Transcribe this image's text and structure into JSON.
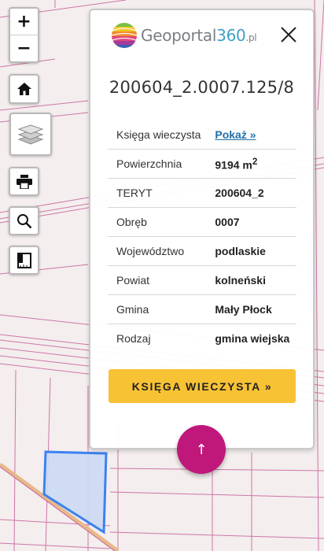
{
  "zoom": {
    "in_label": "+",
    "out_label": "−"
  },
  "panel": {
    "logo": {
      "name": "Geoportal",
      "number": "360",
      "tld": ".pl"
    },
    "parcel_id": "200604_2.0007.125/8",
    "rows": [
      {
        "label": "Księga wieczysta",
        "value": "Pokaż »",
        "link": true
      },
      {
        "label": "Powierzchnia",
        "value": "9194 m",
        "sup": "2"
      },
      {
        "label": "TERYT",
        "value": "200604_2"
      },
      {
        "label": "Obręb",
        "value": "0007"
      },
      {
        "label": "Województwo",
        "value": "podlaskie"
      },
      {
        "label": "Powiat",
        "value": "kolneński"
      },
      {
        "label": "Gmina",
        "value": "Mały Płock"
      },
      {
        "label": "Rodzaj",
        "value": "gmina wiejska"
      }
    ],
    "button_label": "KSIĘGA WIECZYSTA »"
  },
  "fab_label": "↑",
  "colors": {
    "map_background": "#f4eeee",
    "parcel_lines": "#c8609a",
    "selected_parcel": "#3b82f0",
    "road": "#e7b98a",
    "button": "#f8c235",
    "fab": "#c0177b"
  }
}
